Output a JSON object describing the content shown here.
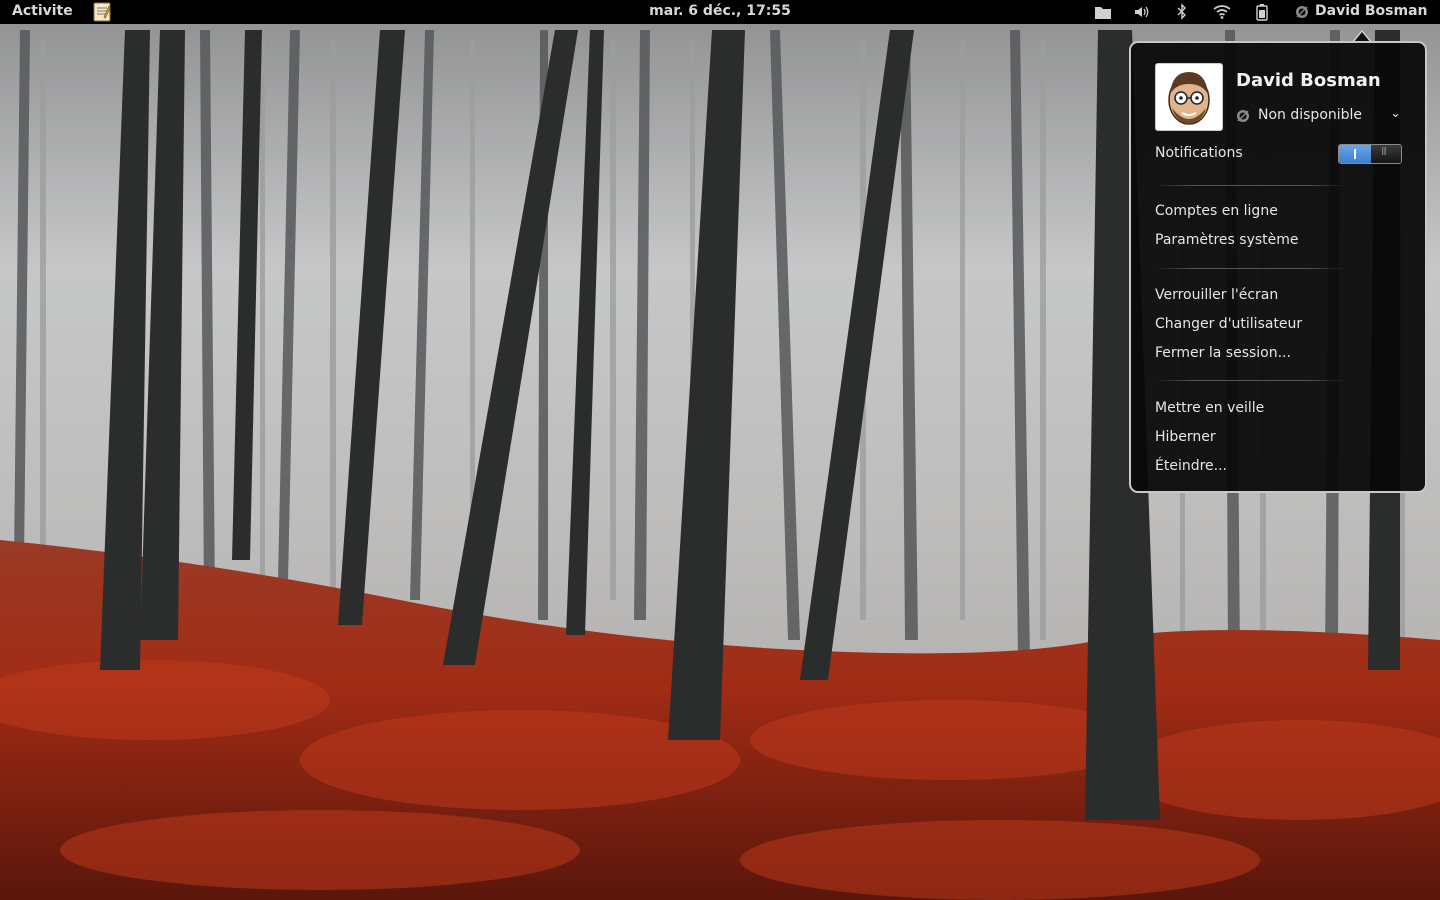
{
  "top_panel": {
    "activities_label": "Activite",
    "clock": "mar.  6 déc., 17:55",
    "user_name": "David Bosman",
    "tray_icons": [
      "folder-icon",
      "volume-icon",
      "bluetooth-icon",
      "wifi-icon",
      "battery-icon"
    ]
  },
  "user_menu": {
    "name": "David Bosman",
    "status": "Non disponible",
    "notifications_label": "Notifications",
    "notifications_enabled": true,
    "items": [
      "Comptes en ligne",
      "Paramètres système",
      "Verrouiller l'écran",
      "Changer d'utilisateur",
      "Fermer la session...",
      "Mettre en veille",
      "Hiberner",
      "Éteindre..."
    ]
  },
  "colors": {
    "panel_bg": "#000000",
    "menu_bg": "#080808",
    "switch_on": "#3d7dd0",
    "fern_red": "#8f2a17"
  }
}
